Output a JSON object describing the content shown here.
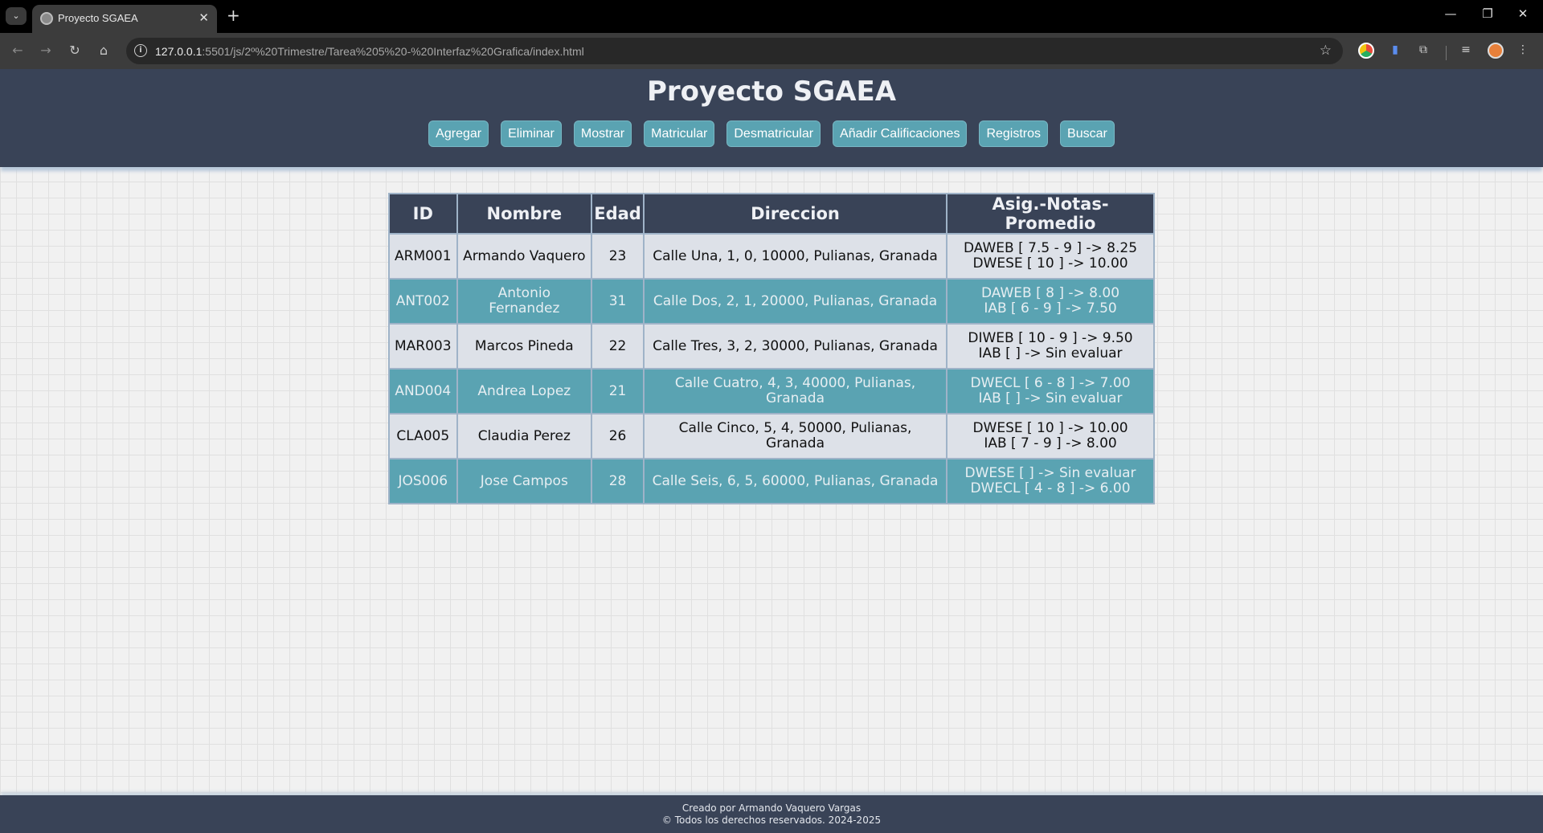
{
  "browser": {
    "tab_title": "Proyecto SGAEA",
    "tab_close": "✕",
    "new_tab": "+",
    "url_host": "127.0.0.1",
    "url_rest": ":5501/js/2º%20Trimestre/Tarea%205%20-%20Interfaz%20Grafica/index.html",
    "icons": [
      "tab-list-icon",
      "back-icon",
      "forward-icon",
      "reload-icon",
      "home-icon",
      "site-info-icon",
      "bookmark-star-icon",
      "extension-icon",
      "media-icon",
      "profile-icon",
      "menu-icon"
    ]
  },
  "header": {
    "title": "Proyecto SGAEA",
    "nav": [
      "Agregar",
      "Eliminar",
      "Mostrar",
      "Matricular",
      "Desmatricular",
      "Añadir Calificaciones",
      "Registros",
      "Buscar"
    ]
  },
  "table": {
    "columns": [
      "ID",
      "Nombre",
      "Edad",
      "Direccion",
      "Asig.-Notas-Promedio"
    ],
    "rows": [
      {
        "id": "ARM001",
        "nombre": "Armando Vaquero",
        "edad": "23",
        "direccion": "Calle Una, 1, 0, 10000, Pulianas, Granada",
        "asig": [
          "DAWEB [ 7.5 - 9 ] -> 8.25",
          "DWESE [ 10 ] -> 10.00"
        ]
      },
      {
        "id": "ANT002",
        "nombre": "Antonio Fernandez",
        "edad": "31",
        "direccion": "Calle Dos, 2, 1, 20000, Pulianas, Granada",
        "asig": [
          "DAWEB [ 8 ] -> 8.00",
          "IAB [ 6 - 9 ] -> 7.50"
        ]
      },
      {
        "id": "MAR003",
        "nombre": "Marcos Pineda",
        "edad": "22",
        "direccion": "Calle Tres, 3, 2, 30000, Pulianas, Granada",
        "asig": [
          "DIWEB [ 10 - 9 ] -> 9.50",
          "IAB [ ] -> Sin evaluar"
        ]
      },
      {
        "id": "AND004",
        "nombre": "Andrea Lopez",
        "edad": "21",
        "direccion": "Calle Cuatro, 4, 3, 40000, Pulianas, Granada",
        "asig": [
          "DWECL [ 6 - 8 ] -> 7.00",
          "IAB [ ] -> Sin evaluar"
        ]
      },
      {
        "id": "CLA005",
        "nombre": "Claudia Perez",
        "edad": "26",
        "direccion": "Calle Cinco, 5, 4, 50000, Pulianas, Granada",
        "asig": [
          "DWESE [ 10 ] -> 10.00",
          "IAB [ 7 - 9 ] -> 8.00"
        ]
      },
      {
        "id": "JOS006",
        "nombre": "Jose Campos",
        "edad": "28",
        "direccion": "Calle Seis, 6, 5, 60000, Pulianas, Granada",
        "asig": [
          "DWESE [ ] -> Sin evaluar",
          "DWECL [ 4 - 8 ] -> 6.00"
        ]
      }
    ]
  },
  "footer": {
    "line1": "Creado por Armando Vaquero Vargas",
    "line2": "© Todos los derechos reservados. 2024-2025"
  },
  "colors": {
    "header_bg": "#394357",
    "accent": "#5aa3b2",
    "row_light": "#dde1e8"
  }
}
